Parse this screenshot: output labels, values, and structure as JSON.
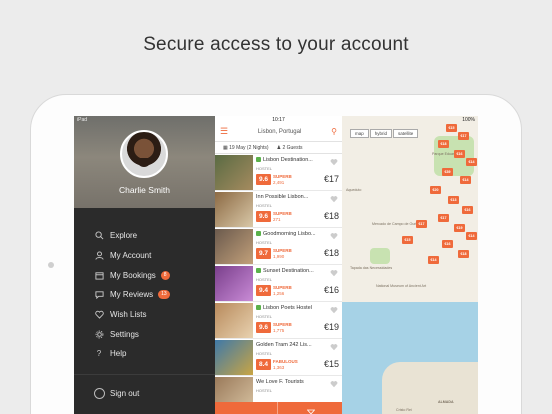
{
  "headline": "Secure access to your account",
  "status_bar": {
    "carrier": "iPad",
    "time": "10:17",
    "battery": "100%"
  },
  "profile": {
    "name": "Charlie Smith"
  },
  "menu": {
    "items": [
      {
        "label": "Explore",
        "icon": "search-icon"
      },
      {
        "label": "My Account",
        "icon": "user-icon"
      },
      {
        "label": "My Bookings",
        "icon": "calendar-icon",
        "badge": "8"
      },
      {
        "label": "My Reviews",
        "icon": "chat-bubble-icon",
        "badge": "13"
      },
      {
        "label": "Wish Lists",
        "icon": "heart-icon"
      },
      {
        "label": "Settings",
        "icon": "gear-icon"
      },
      {
        "label": "Help",
        "icon": "question-icon"
      }
    ],
    "signout": "Sign out"
  },
  "list_header": {
    "location": "Lisbon, Portugal",
    "dates": "19 May (2 Nights)",
    "guests": "2 Guests"
  },
  "properties": [
    {
      "name": "Lisbon Destination...",
      "type": "HOSTEL",
      "score": "9.6",
      "rating": "SUPERB",
      "reviews": "2,491",
      "price": "€17",
      "featured": true,
      "colors": [
        "#5a6b43",
        "#a58b5f"
      ]
    },
    {
      "name": "Inn Possible Lisbon...",
      "type": "HOSTEL",
      "score": "9.6",
      "rating": "SUPERB",
      "reviews": "271",
      "price": "€18",
      "featured": false,
      "colors": [
        "#8c6a44",
        "#d9c8a8"
      ]
    },
    {
      "name": "Goodmorning Lisbo...",
      "type": "HOSTEL",
      "score": "9.7",
      "rating": "SUPERB",
      "reviews": "1,990",
      "price": "€18",
      "featured": true,
      "colors": [
        "#6b5a4d",
        "#c2a07a"
      ]
    },
    {
      "name": "Sunset Destination...",
      "type": "HOSTEL",
      "score": "9.4",
      "rating": "SUPERB",
      "reviews": "1,256",
      "price": "€16",
      "featured": true,
      "colors": [
        "#7a3f8c",
        "#c98bd6"
      ]
    },
    {
      "name": "Lisbon Poets Hostel",
      "type": "HOSTEL",
      "score": "9.6",
      "rating": "SUPERB",
      "reviews": "1,775",
      "price": "€19",
      "featured": true,
      "colors": [
        "#b88a5c",
        "#e8d2b0"
      ]
    },
    {
      "name": "Golden Tram 242 Lis...",
      "type": "HOSTEL",
      "score": "8.4",
      "rating": "FABULOUS",
      "reviews": "1,363",
      "price": "€15",
      "featured": false,
      "colors": [
        "#3f79a8",
        "#c9a544"
      ]
    },
    {
      "name": "We Love F. Tourists",
      "type": "HOSTEL",
      "score": "",
      "rating": "",
      "reviews": "",
      "price": "",
      "featured": false,
      "colors": [
        "#9a7a5a",
        "#d8c3a2"
      ]
    }
  ],
  "map": {
    "toolbar": [
      "map",
      "hybrid",
      "satellite"
    ],
    "labels": [
      "Parque Eduardo VII",
      "Mercado de Campo de Ourique",
      "Tapada das Necessidades",
      "Aqueduto",
      "National Museum of Ancient Art",
      "ALMADA",
      "Cristo Rei"
    ],
    "pins": [
      "€15",
      "€17",
      "€18",
      "€16",
      "€14",
      "€39",
      "€14",
      "€20",
      "€13",
      "€16",
      "€17",
      "€19",
      "€14",
      "€16",
      "€18",
      "€17",
      "€15",
      "€14"
    ]
  },
  "colors": {
    "accent": "#ef6a3b",
    "menu_bg": "#2b2b2b",
    "rating_green": "#5bb14b"
  }
}
